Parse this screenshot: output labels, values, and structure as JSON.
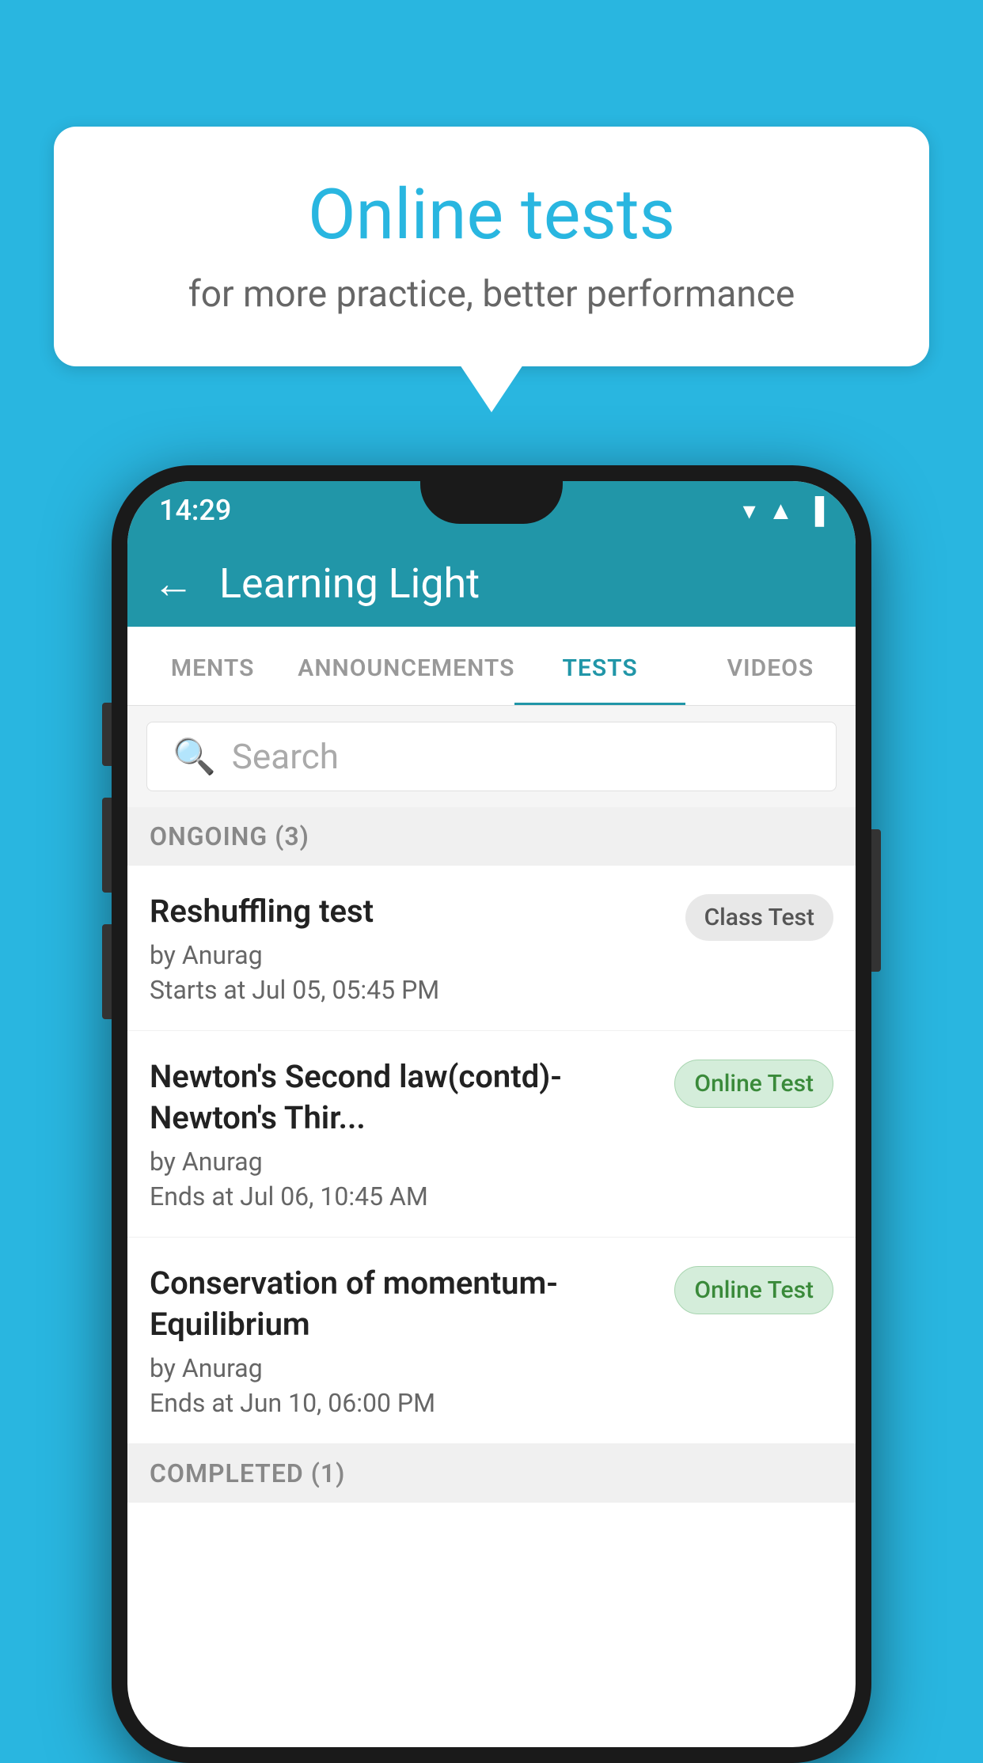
{
  "background_color": "#29b6e0",
  "speech_bubble": {
    "title": "Online tests",
    "subtitle": "for more practice, better performance"
  },
  "status_bar": {
    "time": "14:29",
    "icons": [
      "wifi",
      "signal",
      "battery"
    ]
  },
  "app_bar": {
    "back_label": "←",
    "title": "Learning Light"
  },
  "tabs": [
    {
      "label": "MENTS",
      "active": false
    },
    {
      "label": "ANNOUNCEMENTS",
      "active": false
    },
    {
      "label": "TESTS",
      "active": true
    },
    {
      "label": "VIDEOS",
      "active": false
    }
  ],
  "search": {
    "placeholder": "Search"
  },
  "ongoing_section": {
    "title": "ONGOING (3)"
  },
  "tests": [
    {
      "name": "Reshuffling test",
      "author": "by Anurag",
      "time_label": "Starts at",
      "time": "Jul 05, 05:45 PM",
      "badge": "Class Test",
      "badge_type": "class"
    },
    {
      "name": "Newton's Second law(contd)-Newton's Thir...",
      "author": "by Anurag",
      "time_label": "Ends at",
      "time": "Jul 06, 10:45 AM",
      "badge": "Online Test",
      "badge_type": "online"
    },
    {
      "name": "Conservation of momentum-Equilibrium",
      "author": "by Anurag",
      "time_label": "Ends at",
      "time": "Jun 10, 06:00 PM",
      "badge": "Online Test",
      "badge_type": "online"
    }
  ],
  "completed_section": {
    "title": "COMPLETED (1)"
  }
}
